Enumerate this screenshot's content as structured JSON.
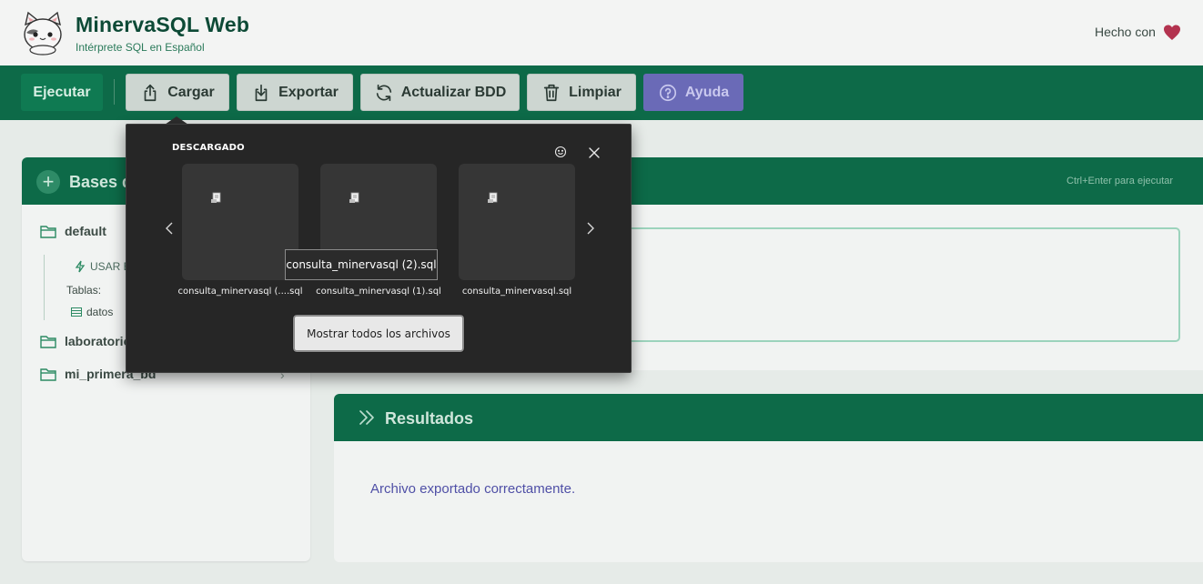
{
  "header": {
    "title": "MinervaSQL Web",
    "subtitle": "Intérprete SQL en Español",
    "made_with": "Hecho con",
    "heart_color": "#b3334f"
  },
  "toolbar": {
    "run_label": "Ejecutar",
    "load_label": "Cargar",
    "export_label": "Exportar",
    "refresh_label": "Actualizar BDD",
    "clear_label": "Limpiar",
    "help_label": "Ayuda"
  },
  "sidebar": {
    "title": "Bases d",
    "databases": [
      {
        "name": "default"
      },
      {
        "name": "laboratorio"
      },
      {
        "name": "mi_primera_bd"
      }
    ],
    "use_label": "USAR E",
    "tables_label": "Tablas:",
    "tables": [
      "datos"
    ]
  },
  "editor": {
    "hint": "Ctrl+Enter para ejecutar"
  },
  "results": {
    "title": "Resultados",
    "message": "Archivo exportado correctamente."
  },
  "downloads": {
    "title": "DESCARGADO",
    "files": [
      {
        "name": "consulta_minervasql (....sql"
      },
      {
        "name": "consulta_minervasql (1).sql"
      },
      {
        "name": "consulta_minervasql.sql"
      }
    ],
    "tooltip": "consulta_minervasql (2).sql",
    "show_all_label": "Mostrar todos los archivos"
  },
  "colors": {
    "primary": "#0d6a48",
    "help": "#6a6ab7",
    "message": "#4f4fa6"
  }
}
